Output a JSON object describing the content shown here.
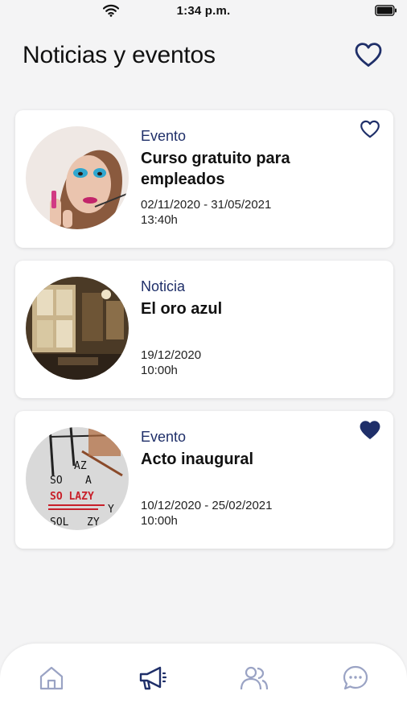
{
  "status_bar": {
    "time": "1:34 p.m.",
    "icons": [
      "wifi-icon",
      "battery-icon"
    ]
  },
  "header": {
    "title": "Noticias y eventos",
    "favorites_icon": "heart-outline-icon"
  },
  "colors": {
    "accent": "#1f2f69",
    "icon_inactive": "#9aa3c4",
    "background": "#f4f4f5"
  },
  "items": [
    {
      "type": "Evento",
      "title": "Curso gratuito para empleados",
      "dates": "02/11/2020 - 31/05/2021",
      "time": "13:40h",
      "favorite": false,
      "favorite_icon": "heart-outline-icon"
    },
    {
      "type": "Noticia",
      "title": "El oro azul",
      "dates": "19/12/2020",
      "time": "10:00h",
      "favorite": null
    },
    {
      "type": "Evento",
      "title": "Acto inaugural",
      "dates": "10/12/2020 - 25/02/2021",
      "time": "10:00h",
      "favorite": true,
      "favorite_icon": "heart-filled-icon",
      "thumbnail_text": [
        "AZ",
        "SO",
        "A",
        "SO LAZY",
        "Y",
        "SOL",
        "ZY"
      ]
    }
  ],
  "tabbar": {
    "tabs": [
      {
        "icon": "home-icon",
        "active": false
      },
      {
        "icon": "megaphone-icon",
        "active": true
      },
      {
        "icon": "users-icon",
        "active": false
      },
      {
        "icon": "chat-icon",
        "active": false
      }
    ]
  }
}
